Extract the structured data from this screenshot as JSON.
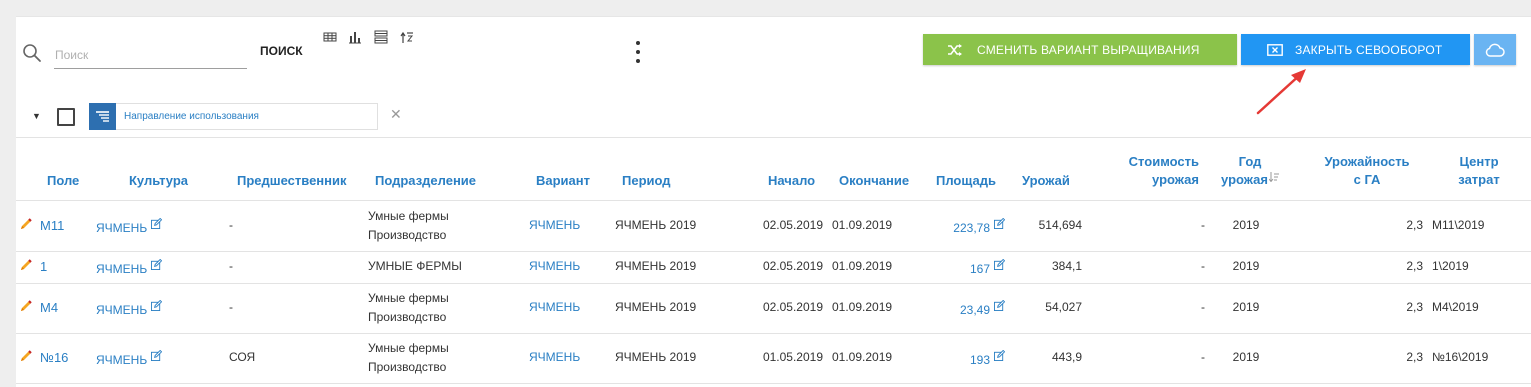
{
  "toolbar": {
    "search_placeholder": "Поиск",
    "search_button": "ПОИСК",
    "change_variant_button": "СМЕНИТЬ ВАРИАНТ ВЫРАЩИВАНИЯ",
    "close_rotation_button": "ЗАКРЫТЬ СЕВООБОРОТ",
    "view_icons": [
      "table-view-icon",
      "chart-view-icon",
      "list-view-icon",
      "sort-toggle-icon"
    ]
  },
  "filter": {
    "chip_label": "Направление использования"
  },
  "table": {
    "headers": {
      "field": "Поле",
      "crop": "Культура",
      "predecessor": "Предшественник",
      "division": "Подразделение",
      "variant": "Вариант",
      "period": "Период",
      "start": "Начало",
      "end": "Окончание",
      "area": "Площадь",
      "harvest": "Урожай",
      "harvest_cost_1": "Стоимость",
      "harvest_cost_2": "урожая",
      "harvest_year_1": "Год",
      "harvest_year_2": "урожая",
      "yield_1": "Урожайность",
      "yield_2": "с ГА",
      "cost_center_1": "Центр",
      "cost_center_2": "затрат"
    },
    "rows": [
      {
        "field": "М11",
        "crop": "ЯЧМЕНЬ",
        "predecessor": "-",
        "division_1": "Умные фермы",
        "division_2": "Производство",
        "variant": "ЯЧМЕНЬ",
        "period": "ЯЧМЕНЬ 2019",
        "start": "02.05.2019",
        "end": "01.09.2019",
        "area": "223,78",
        "harvest": "514,694",
        "harvest_cost": "-",
        "harvest_year": "2019",
        "yield": "2,3",
        "cost_center": "М11\\2019"
      },
      {
        "field": "1",
        "crop": "ЯЧМЕНЬ",
        "predecessor": "-",
        "division_1": "УМНЫЕ ФЕРМЫ",
        "division_2": "",
        "variant": "ЯЧМЕНЬ",
        "period": "ЯЧМЕНЬ 2019",
        "start": "02.05.2019",
        "end": "01.09.2019",
        "area": "167",
        "harvest": "384,1",
        "harvest_cost": "-",
        "harvest_year": "2019",
        "yield": "2,3",
        "cost_center": "1\\2019"
      },
      {
        "field": "М4",
        "crop": "ЯЧМЕНЬ",
        "predecessor": "-",
        "division_1": "Умные фермы",
        "division_2": "Производство",
        "variant": "ЯЧМЕНЬ",
        "period": "ЯЧМЕНЬ 2019",
        "start": "02.05.2019",
        "end": "01.09.2019",
        "area": "23,49",
        "harvest": "54,027",
        "harvest_cost": "-",
        "harvest_year": "2019",
        "yield": "2,3",
        "cost_center": "М4\\2019"
      },
      {
        "field": "№16",
        "crop": "ЯЧМЕНЬ",
        "predecessor": "СОЯ",
        "division_1": "Умные фермы",
        "division_2": "Производство",
        "variant": "ЯЧМЕНЬ",
        "period": "ЯЧМЕНЬ 2019",
        "start": "01.05.2019",
        "end": "01.09.2019",
        "area": "193",
        "harvest": "443,9",
        "harvest_cost": "-",
        "harvest_year": "2019",
        "yield": "2,3",
        "cost_center": "№16\\2019"
      }
    ]
  },
  "colors": {
    "accent_blue": "#2196f3",
    "accent_green": "#8bc34a",
    "link": "#2a7fc4",
    "annotation_arrow": "#e53935"
  }
}
